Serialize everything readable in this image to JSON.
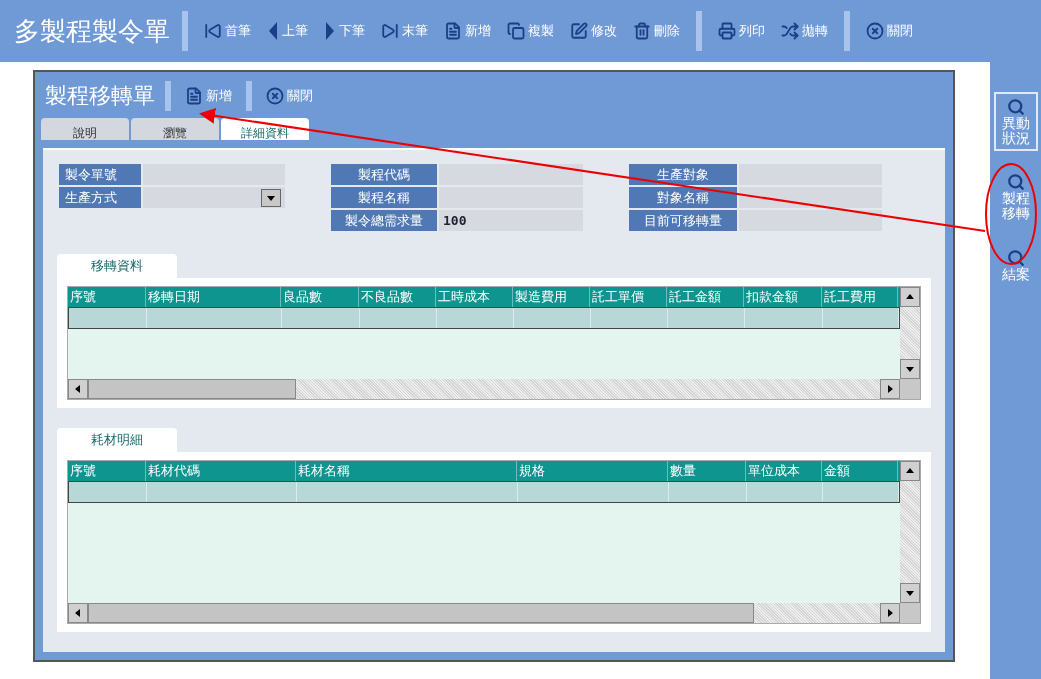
{
  "toolbar": {
    "title": "多製程製令單",
    "groups": [
      [
        "首筆",
        "上筆",
        "下筆",
        "末筆",
        "新增",
        "複製",
        "修改",
        "刪除"
      ],
      [
        "列印",
        "拋轉"
      ],
      [
        "關閉"
      ]
    ]
  },
  "dialog": {
    "title": "製程移轉單",
    "buttons": [
      "新增",
      "關閉"
    ],
    "tabs": [
      {
        "label": "說明",
        "selected": false
      },
      {
        "label": "瀏覽",
        "selected": false
      },
      {
        "label": "詳細資料",
        "selected": true
      }
    ],
    "form": [
      [
        {
          "label": "製令單號",
          "kind": "text"
        },
        {
          "label": "生產方式",
          "kind": "select"
        }
      ],
      [
        {
          "label": "製程代碼",
          "kind": "text"
        },
        {
          "label": "製程名稱",
          "kind": "text"
        },
        {
          "label": "製令總需求量",
          "kind": "text",
          "value": "100"
        }
      ],
      [
        {
          "label": "生產對象",
          "kind": "text"
        },
        {
          "label": "對象名稱",
          "kind": "text"
        },
        {
          "label": "目前可移轉量",
          "kind": "text"
        }
      ]
    ],
    "grids": [
      {
        "tab": "移轉資料",
        "columns": [
          "序號",
          "移轉日期",
          "良品數",
          "不良品數",
          "工時成本",
          "製造費用",
          "託工單價",
          "託工金額",
          "扣款金額",
          "託工費用"
        ]
      },
      {
        "tab": "耗材明細",
        "columns": [
          "序號",
          "耗材代碼",
          "耗材名稱",
          "規格",
          "數量",
          "單位成本",
          "金額"
        ]
      }
    ]
  },
  "sidebar": [
    {
      "label": "異動狀況",
      "selected": true
    },
    {
      "label": "製程移轉",
      "selected": false
    },
    {
      "label": "結案",
      "selected": false
    }
  ]
}
